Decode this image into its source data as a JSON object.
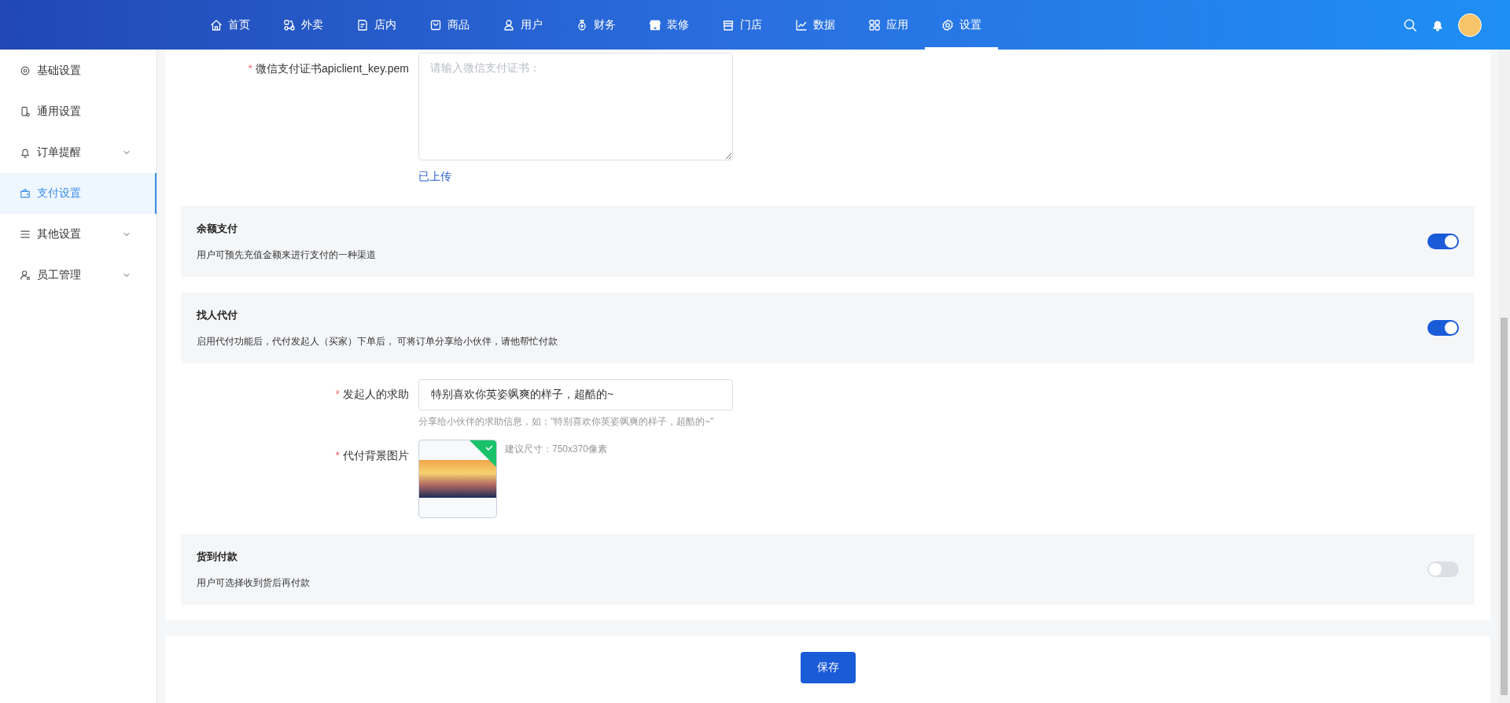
{
  "top_nav": {
    "items": [
      {
        "label": "首页",
        "selected": false
      },
      {
        "label": "外卖",
        "selected": false
      },
      {
        "label": "店内",
        "selected": false
      },
      {
        "label": "商品",
        "selected": false
      },
      {
        "label": "用户",
        "selected": false
      },
      {
        "label": "财务",
        "selected": false
      },
      {
        "label": "装修",
        "selected": false
      },
      {
        "label": "门店",
        "selected": false
      },
      {
        "label": "数据",
        "selected": false
      },
      {
        "label": "应用",
        "selected": false
      },
      {
        "label": "设置",
        "selected": true
      }
    ]
  },
  "sidebar": {
    "items": [
      {
        "label": "基础设置",
        "selected": false,
        "has_submenu": false
      },
      {
        "label": "通用设置",
        "selected": false,
        "has_submenu": false
      },
      {
        "label": "订单提醒",
        "selected": false,
        "has_submenu": true
      },
      {
        "label": "支付设置",
        "selected": true,
        "has_submenu": false
      },
      {
        "label": "其他设置",
        "selected": false,
        "has_submenu": true
      },
      {
        "label": "员工管理",
        "selected": false,
        "has_submenu": true
      }
    ]
  },
  "form": {
    "rows": [
      {
        "kind": "textarea",
        "label": "微信支付证书apiclient_key.pem",
        "required_mark": "*",
        "placeholder": "请输入微信支付证书：",
        "status": "已上传"
      },
      {
        "kind": "toggle_section",
        "title": "余额支付",
        "description": "用户可预先充值金额来进行支付的一种渠道",
        "on": true
      },
      {
        "kind": "toggle_section",
        "title": "找人代付",
        "description": "启用代付功能后，代付发起人（买家）下单后， 可将订单分享给小伙伴，请他帮忙付款",
        "on": true
      },
      {
        "kind": "text_field",
        "label": "发起人的求助",
        "required_mark": "*",
        "value": "特别喜欢你英姿飒爽的样子，超酷的~",
        "hint": "分享给小伙伴的求助信息，如：\"特别喜欢你英姿飒爽的样子，超酷的~\""
      },
      {
        "kind": "image_upload",
        "label": "代付背景图片",
        "required_mark": "*",
        "uploaded": true,
        "hint": "建议尺寸：750x370像素"
      },
      {
        "kind": "toggle_section",
        "title": "货到付款",
        "description": "用户可选择收到货后再付款",
        "on": false
      }
    ]
  },
  "save_button": "保存"
}
